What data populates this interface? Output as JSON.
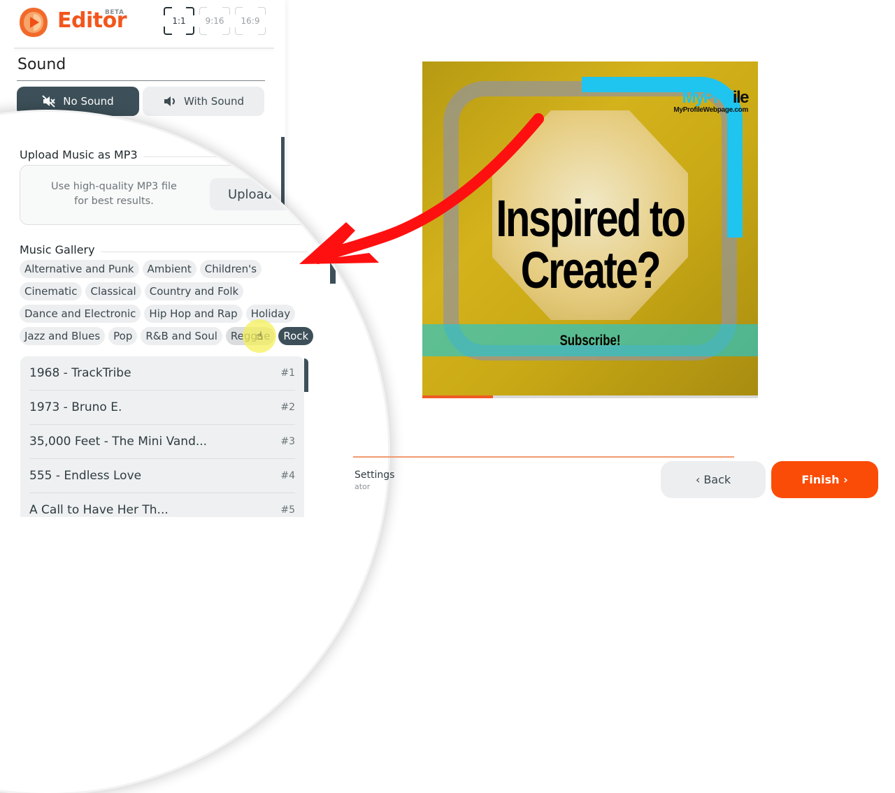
{
  "app": {
    "name": "Editor",
    "badge": "BETA"
  },
  "aspect_ratios": [
    {
      "label": "1:1",
      "active": true
    },
    {
      "label": "9:16",
      "active": false
    },
    {
      "label": "16:9",
      "active": false
    }
  ],
  "sound": {
    "title": "Sound",
    "toggle": [
      {
        "label": "No Sound",
        "icon": "speaker-muted-icon",
        "active": true
      },
      {
        "label": "With Sound",
        "icon": "speaker-icon",
        "active": false
      }
    ]
  },
  "upload": {
    "title": "Upload Music as MP3",
    "hint_line1": "Use high-quality MP3 file",
    "hint_line2": "for best results.",
    "button": "Upload"
  },
  "gallery": {
    "title": "Music Gallery",
    "genre_rows": [
      [
        "Alternative and Punk",
        "Ambient",
        "Children's"
      ],
      [
        "Cinematic",
        "Classical",
        "Country and Folk"
      ],
      [
        "Dance and Electronic",
        "Hip Hop and Rap",
        "Holiday"
      ],
      [
        "Jazz and Blues",
        "Pop",
        "R&B and Soul",
        "Reggae",
        "Rock"
      ]
    ],
    "selected_genre": "Rock",
    "hovered_genre": "Reggae",
    "tracks": [
      {
        "title": "1968 - TrackTribe",
        "rank": "#1"
      },
      {
        "title": "1973 - Bruno E.",
        "rank": "#2"
      },
      {
        "title": "35,000 Feet - The Mini Vand...",
        "rank": "#3"
      },
      {
        "title": "555 - Endless Love",
        "rank": "#4"
      },
      {
        "title": "A Call to Have Her Th...",
        "rank": "#5"
      }
    ]
  },
  "preview": {
    "headline_line1": "Inspired to",
    "headline_line2": "Create?",
    "cta": "Subscribe!",
    "brand_name_part1": "MyProf",
    "brand_name_part2": "ile",
    "brand_url": "MyProfileWebpage.com",
    "playback_progress": 0.21
  },
  "footer": {
    "hint": "Settings",
    "hint_sub": "ator",
    "back": "Back",
    "finish": "Finish"
  },
  "colors": {
    "accent": "#fb4c07",
    "dark": "#3d5059",
    "annotation_arrow": "#ff1010"
  }
}
